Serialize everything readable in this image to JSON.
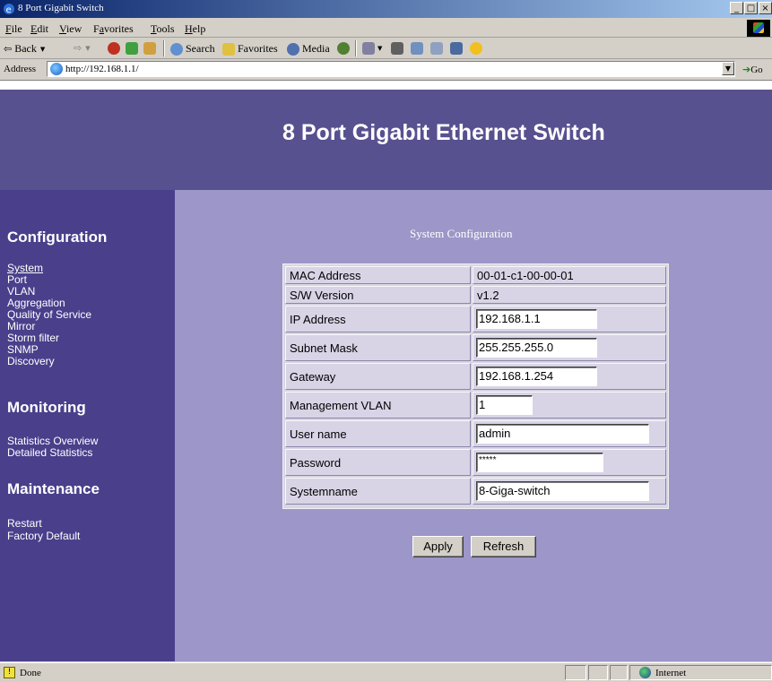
{
  "window": {
    "title": "8 Port Gigabit Switch"
  },
  "menu": [
    {
      "label": "File",
      "ul": "F",
      "rest": "ile"
    },
    {
      "label": "Edit",
      "ul": "E",
      "rest": "dit"
    },
    {
      "label": "View",
      "ul": "V",
      "rest": "iew"
    },
    {
      "label": "Favorites",
      "ul": "a",
      "pre": "F",
      "rest": "vorites"
    },
    {
      "label": "Tools",
      "ul": "T",
      "rest": "ools"
    },
    {
      "label": "Help",
      "ul": "H",
      "rest": "elp"
    }
  ],
  "toolbar": {
    "back": "Back",
    "search": "Search",
    "favorites": "Favorites",
    "media": "Media"
  },
  "address": {
    "label": "Address",
    "url": "http://192.168.1.1/",
    "go": "Go"
  },
  "page": {
    "heading": "8 Port Gigabit Ethernet Switch",
    "sidebar": {
      "configuration": "Configuration",
      "config_links": [
        "System",
        "Port",
        "VLAN",
        "Aggregation",
        "Quality of Service",
        "Mirror",
        "Storm filter",
        "SNMP",
        "Discovery"
      ],
      "monitoring": "Monitoring",
      "monitoring_links": [
        "Statistics Overview",
        "Detailed Statistics"
      ],
      "maintenance": "Maintenance",
      "maintenance_links": [
        "Restart",
        "Factory Default"
      ]
    },
    "form": {
      "title": "System Configuration",
      "mac_label": "MAC Address",
      "mac_value": "00-01-c1-00-00-01",
      "sw_label": "S/W Version",
      "sw_value": "v1.2",
      "ip_label": "IP Address",
      "ip_value": "192.168.1.1",
      "subnet_label": "Subnet Mask",
      "subnet_value": "255.255.255.0",
      "gateway_label": "Gateway",
      "gateway_value": "192.168.1.254",
      "mvlan_label": "Management VLAN",
      "mvlan_value": "1",
      "user_label": "User name",
      "user_value": "admin",
      "password_label": "Password",
      "password_value": "*****",
      "sysname_label": "Systemname",
      "sysname_value": "8-Giga-switch",
      "apply": "Apply",
      "refresh": "Refresh"
    }
  },
  "status": {
    "text": "Done",
    "zone": "Internet"
  },
  "colors": {
    "header_bg": "#57518f",
    "sidebar_bg": "#4a3f8b",
    "content_bg": "#9d96c8",
    "table_bg": "#d9d5e5"
  }
}
